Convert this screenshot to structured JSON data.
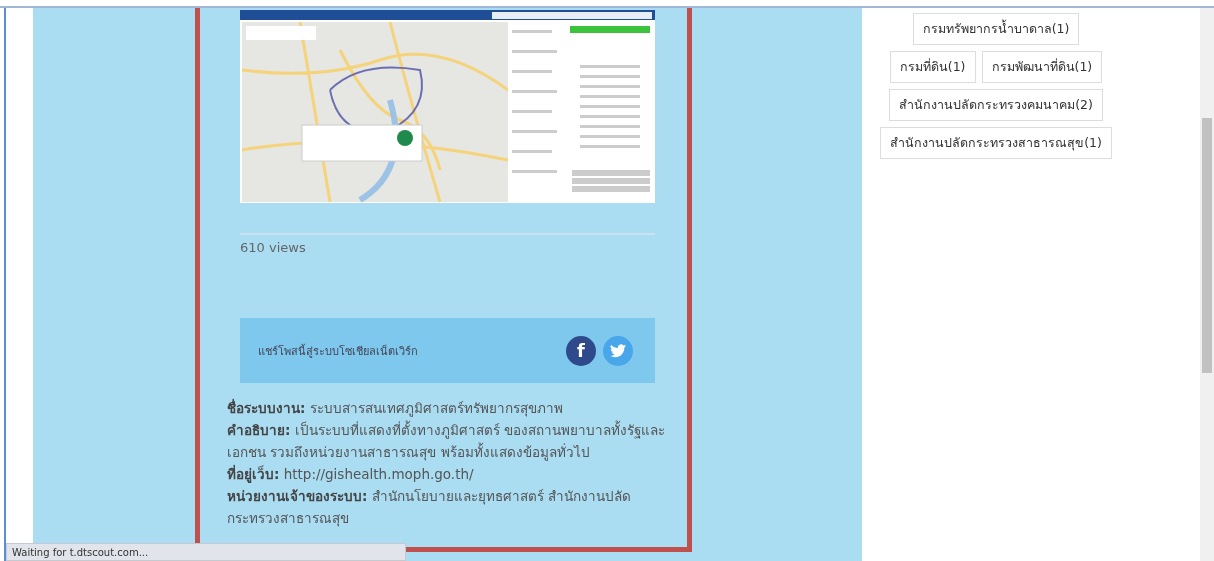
{
  "post": {
    "views": "610 views",
    "share": {
      "label": "แชร์โพสนี้สู่ระบบโซเชียลเน็ตเวิร์ก",
      "icons": [
        {
          "kind": "facebook",
          "glyph": "f"
        },
        {
          "kind": "twitter"
        }
      ]
    },
    "details": [
      "**ชื่อระบบงาน:** ระบบสารสนเทศภูมิศาสตร์ทรัพยากรสุขภาพ",
      "**คำอธิบาย:** เป็นระบบที่แสดงที่ตั้งทางภูมิศาสตร์ ของสถานพยาบาลทั้งรัฐและเอกชน รวมถึงหน่วยงานสาธารณสุข พร้อมทั้งแสดงข้อมูลทั่วไป",
      "**ที่อยู่เว็บ:** http://gishealth.moph.go.th/",
      "**หน่วยงานเจ้าของระบบ:** สำนักนโยบายและยุทธศาสตร์ สำนักงานปลัดกระทรวงสาธารณสุข"
    ]
  },
  "tags": [
    [
      "กรมทรัพยากรน้ำบาดาล(1)"
    ],
    [
      "กรมที่ดิน(1)",
      "กรมพัฒนาที่ดิน(1)"
    ],
    [
      "สำนักงานปลัดกระทรวงคมนาคม(2)"
    ],
    [
      "สำนักงานปลัดกระทรวงสาธารณสุข(1)"
    ]
  ],
  "status_bar": "Waiting for t.dtscout.com..."
}
